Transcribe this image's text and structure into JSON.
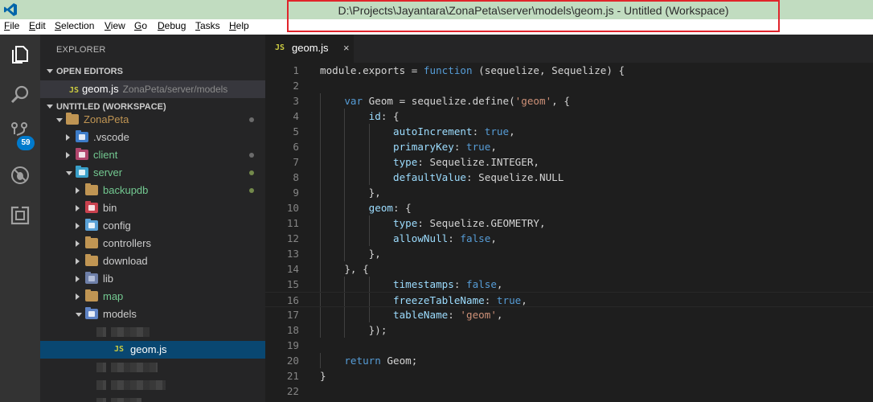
{
  "window": {
    "title": "D:\\Projects\\Jayantara\\ZonaPeta\\server\\models\\geom.js - Untitled (Workspace)"
  },
  "menu": [
    {
      "acc": "F",
      "rest": "ile"
    },
    {
      "acc": "E",
      "rest": "dit"
    },
    {
      "acc": "S",
      "rest": "election"
    },
    {
      "acc": "V",
      "rest": "iew"
    },
    {
      "acc": "G",
      "rest": "o"
    },
    {
      "acc": "D",
      "rest": "ebug"
    },
    {
      "acc": "T",
      "rest": "asks"
    },
    {
      "acc": "H",
      "rest": "elp"
    }
  ],
  "activity_bar": {
    "icons": [
      "explorer-icon",
      "search-icon",
      "source-control-icon",
      "debug-icon",
      "extensions-icon"
    ],
    "scm_badge": "59"
  },
  "explorer": {
    "title": "EXPLORER",
    "open_editors_label": "OPEN EDITORS",
    "open_editor": {
      "badge": "JS",
      "name": "geom.js",
      "path": "ZonaPeta/server/models"
    },
    "workspace_label": "UNTITLED (WORKSPACE)",
    "tree": [
      {
        "name": "ZonaPeta",
        "state": "open",
        "depth": 0,
        "color": "#c09553"
      },
      {
        "name": ".vscode",
        "state": "closed",
        "depth": 1,
        "color": "#cccccc"
      },
      {
        "name": "client",
        "state": "closed",
        "depth": 1,
        "color": "#73c991"
      },
      {
        "name": "server",
        "state": "open",
        "depth": 1,
        "color": "#73c991"
      },
      {
        "name": "backupdb",
        "state": "closed",
        "depth": 2,
        "color": "#73c991"
      },
      {
        "name": "bin",
        "state": "closed",
        "depth": 2,
        "color": "#cccccc"
      },
      {
        "name": "config",
        "state": "closed",
        "depth": 2,
        "color": "#cccccc"
      },
      {
        "name": "controllers",
        "state": "closed",
        "depth": 2,
        "color": "#cccccc"
      },
      {
        "name": "download",
        "state": "closed",
        "depth": 2,
        "color": "#cccccc"
      },
      {
        "name": "lib",
        "state": "closed",
        "depth": 2,
        "color": "#cccccc"
      },
      {
        "name": "map",
        "state": "closed",
        "depth": 2,
        "color": "#73c991"
      },
      {
        "name": "models",
        "state": "open",
        "depth": 2,
        "color": "#cccccc"
      },
      {
        "name": "geom.js",
        "state": "file",
        "depth": 3,
        "color": "#ffffff",
        "selected": true,
        "badge": "JS"
      }
    ]
  },
  "editor": {
    "tab": {
      "badge": "JS",
      "name": "geom.js",
      "close": "×"
    },
    "lines": [
      "module.exports = function (sequelize, Sequelize) {",
      "",
      "    var Geom = sequelize.define('geom', {",
      "        id: {",
      "            autoIncrement: true,",
      "            primaryKey: true,",
      "            type: Sequelize.INTEGER,",
      "            defaultValue: Sequelize.NULL",
      "        },",
      "        geom: {",
      "            type: Sequelize.GEOMETRY,",
      "            allowNull: false,",
      "        },",
      "    }, {",
      "            timestamps: false,",
      "            freezeTableName: true,",
      "            tableName: 'geom',",
      "        });",
      "",
      "    return Geom;",
      "}",
      ""
    ],
    "current_line": 16
  },
  "colors": {
    "accent": "#007acc",
    "selection": "#094771",
    "js_badge": "#cbcb41",
    "git_modified": "#73c991"
  }
}
